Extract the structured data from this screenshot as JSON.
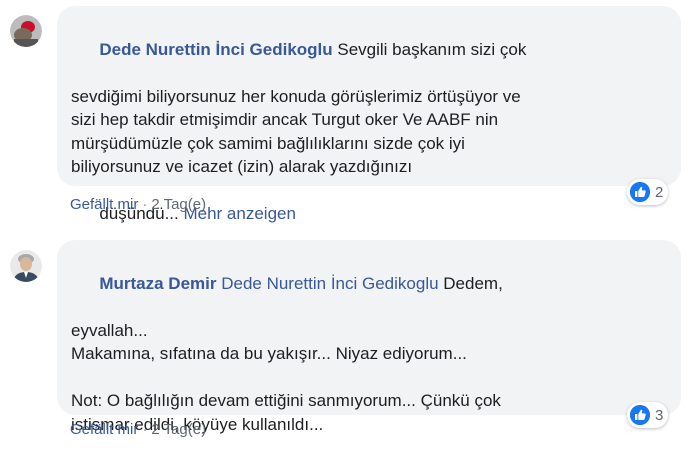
{
  "comments": [
    {
      "author": "Dede Nurettin İnci Gedikoglu",
      "mention": "",
      "text_lines": [
        " Sevgili başkanım sizi çok",
        "sevdiğimi biliyorsunuz her konuda görüşlerimiz örtüşüyor ve",
        "sizi hep takdir etmişimdir ancak Turgut oker Ve AABF nin",
        "mürşüdümüzle çok samimi bağlılıklarını sizde çok iyi",
        "biliyorsunuz ve icazet (izin) alarak yazdığınızı",
        "düşündü..."
      ],
      "see_more": " Mehr anzeigen",
      "reaction_count": "2",
      "like_label": "Gefällt mir",
      "separator": "·",
      "time": "2 Tag(e)"
    },
    {
      "author": "Murtaza Demir",
      "mention": " Dede Nurettin İnci Gedikoglu",
      "text_lines": [
        " Dedem,",
        "eyvallah...",
        "Makamına, sıfatına da bu yakışır... Niyaz ediyorum...",
        "",
        "Not: O bağlılığın devam ettiğini sanmıyorum... Çünkü çok",
        "istismar edildi, köyüye kullanıldı..."
      ],
      "see_more": "",
      "reaction_count": "3",
      "like_label": "Gefällt mir",
      "separator": "·",
      "time": "2 Tag(e)"
    }
  ],
  "colors": {
    "name": "#385898",
    "bubble": "#f2f3f5",
    "like": "#1877f2",
    "meta": "#606770"
  },
  "icons": [
    "avatar-red-flag",
    "avatar-man-grey-hair",
    "thumbs-up-icon"
  ]
}
